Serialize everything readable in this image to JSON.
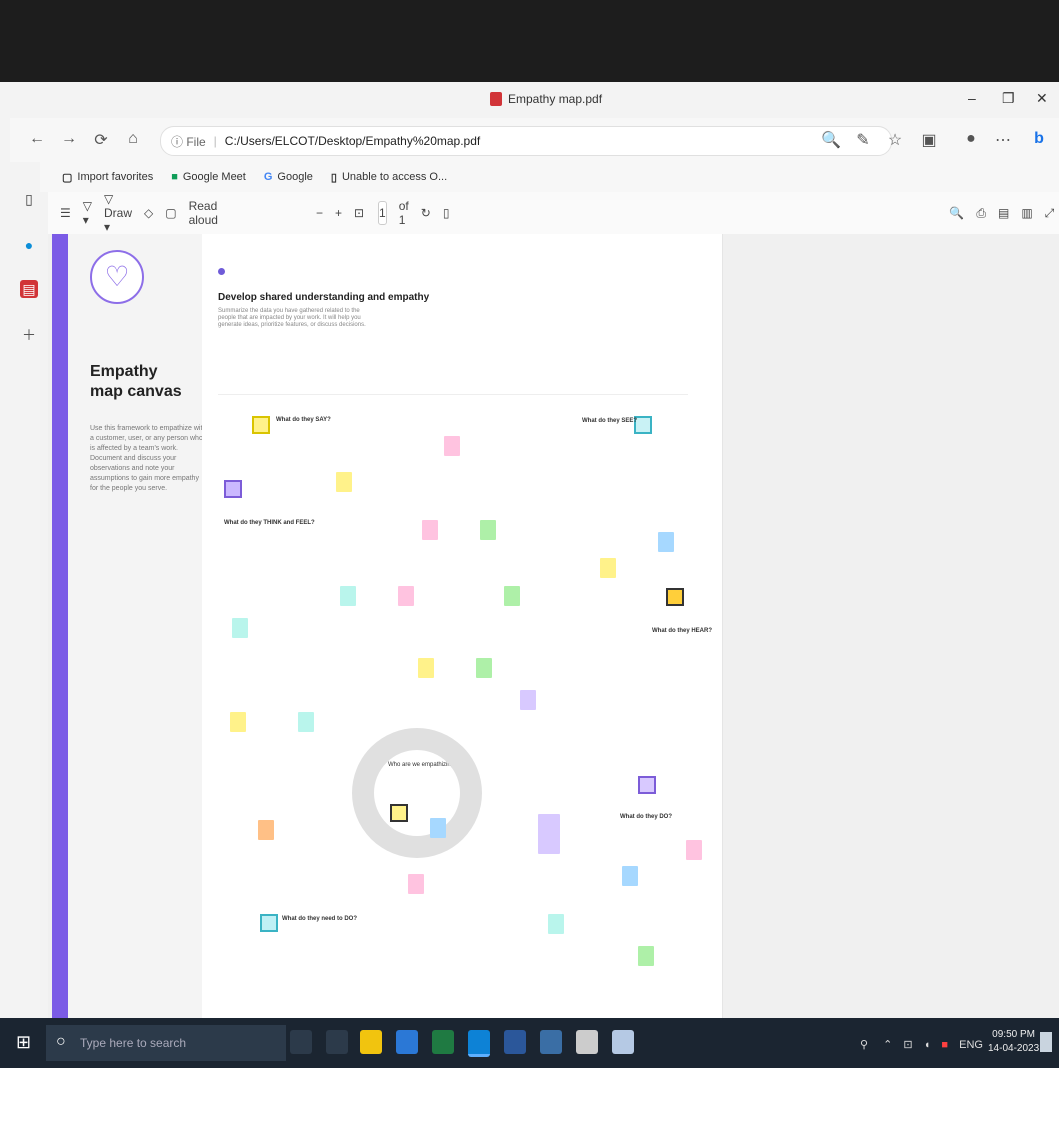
{
  "window": {
    "title": "Empathy map.pdf",
    "minimize": "–",
    "restore": "❐",
    "close": "✕"
  },
  "nav": {
    "back": "←",
    "forward": "→",
    "refresh": "⟳",
    "home": "⌂",
    "info": "ⓘ File",
    "url": "C:/Users/ELCOT/Desktop/Empathy%20map.pdf"
  },
  "favorites": [
    {
      "icon": "import-icon",
      "label": "Import favorites"
    },
    {
      "icon": "meet-icon",
      "label": "Google Meet"
    },
    {
      "icon": "google-icon",
      "label": "Google"
    },
    {
      "icon": "page-icon",
      "label": "Unable to access O..."
    }
  ],
  "pdf_toolbar": {
    "draw": "Draw",
    "read_aloud": "Read aloud",
    "page_number": "1",
    "page_total": "of 1",
    "zoom_out": "−",
    "zoom_in": "+"
  },
  "document": {
    "left_title": "Empathy map canvas",
    "left_desc": "Use this framework to empathize with a customer, user, or any person who is affected by a team's work. Document and discuss your observations and note your assumptions to gain more empathy for the people you serve.",
    "section_title": "Develop shared understanding and empathy",
    "section_desc": "Summarize the data you have gathered related to the people that are impacted by your work. It will help you generate ideas, prioritize features, or discuss decisions.",
    "labels": {
      "say": "What do they SAY?",
      "think_feel": "What do they THINK and FEEL?",
      "see": "What do they SEE?",
      "hear": "What do they HEAR?",
      "do": "What do they DO?",
      "need": "What do they need to DO?",
      "center": "Who are we empathizing with?"
    }
  },
  "taskbar": {
    "search_placeholder": "Type here to search",
    "time": "09:50 PM",
    "date": "14-04-2023",
    "lang": "ENG"
  },
  "colors": {
    "accent": "#7b5be6",
    "topbar": "#1d1d1d",
    "taskbar": "#1b2531"
  }
}
